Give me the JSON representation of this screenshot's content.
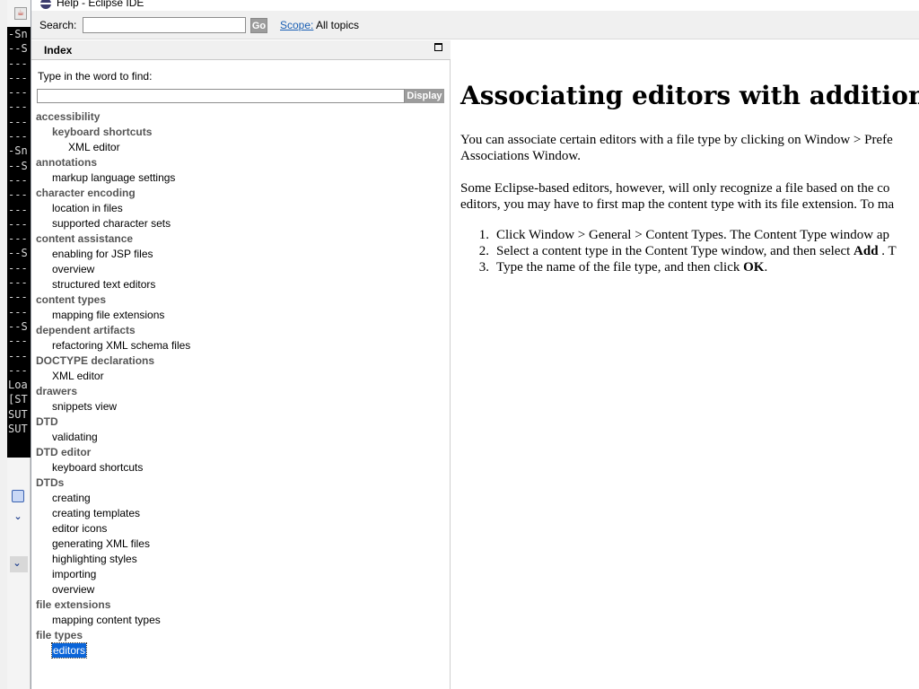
{
  "background": {
    "console_lines": [
      "-Sn",
      "--S",
      "---",
      "---",
      "---",
      "---",
      "---",
      "---",
      "-Sn",
      "--S",
      "---",
      "---",
      "---",
      "---",
      "---",
      "--S",
      "---",
      "---",
      "---",
      "---",
      "--S",
      "---",
      "---",
      "---",
      "Loa",
      "[ST",
      "SUT",
      "SUT"
    ],
    "java_icon": "java-icon"
  },
  "window": {
    "title": "Help - Eclipse IDE",
    "icon": "eclipse-icon"
  },
  "searchbar": {
    "label": "Search:",
    "value": "",
    "go_label": "Go",
    "scope_link": "Scope:",
    "scope_value": "All topics"
  },
  "nav": {
    "title": "Index",
    "find_label": "Type in the word to find:",
    "find_value": "",
    "display_label": "Display",
    "items": [
      {
        "level": 0,
        "text": "accessibility"
      },
      {
        "level": 1,
        "text": "keyboard shortcuts",
        "group": true
      },
      {
        "level": 2,
        "text": "XML editor"
      },
      {
        "level": 0,
        "text": "annotations"
      },
      {
        "level": 1,
        "text": "markup language settings"
      },
      {
        "level": 0,
        "text": "character encoding"
      },
      {
        "level": 1,
        "text": "location in files"
      },
      {
        "level": 1,
        "text": "supported character sets"
      },
      {
        "level": 0,
        "text": "content assistance"
      },
      {
        "level": 1,
        "text": "enabling for JSP files"
      },
      {
        "level": 1,
        "text": "overview"
      },
      {
        "level": 1,
        "text": "structured text editors"
      },
      {
        "level": 0,
        "text": "content types"
      },
      {
        "level": 1,
        "text": "mapping file extensions"
      },
      {
        "level": 0,
        "text": "dependent artifacts"
      },
      {
        "level": 1,
        "text": "refactoring XML schema files"
      },
      {
        "level": 0,
        "text": "DOCTYPE declarations"
      },
      {
        "level": 1,
        "text": "XML editor"
      },
      {
        "level": 0,
        "text": "drawers"
      },
      {
        "level": 1,
        "text": "snippets view"
      },
      {
        "level": 0,
        "text": "DTD"
      },
      {
        "level": 1,
        "text": "validating"
      },
      {
        "level": 0,
        "text": "DTD editor"
      },
      {
        "level": 1,
        "text": "keyboard shortcuts"
      },
      {
        "level": 0,
        "text": "DTDs"
      },
      {
        "level": 1,
        "text": "creating"
      },
      {
        "level": 1,
        "text": "creating templates"
      },
      {
        "level": 1,
        "text": "editor icons"
      },
      {
        "level": 1,
        "text": "generating XML files"
      },
      {
        "level": 1,
        "text": "highlighting styles"
      },
      {
        "level": 1,
        "text": "importing"
      },
      {
        "level": 1,
        "text": "overview"
      },
      {
        "level": 0,
        "text": "file extensions"
      },
      {
        "level": 1,
        "text": "mapping content types"
      },
      {
        "level": 0,
        "text": "file types"
      },
      {
        "level": 1,
        "text": "editors",
        "selected": true
      }
    ]
  },
  "content": {
    "title": "Associating editors with additional file",
    "para1_line1": "You can associate certain editors with a file type by clicking on Window > Prefe",
    "para1_line2": "Associations Window.",
    "para2_line1": "Some Eclipse-based editors, however, will only recognize a file based on the co",
    "para2_line2": "editors, you may have to first map the content type with its file extension. To ma",
    "steps": [
      {
        "num": "1.",
        "text": "Click Window > General > Content Types. The Content Type window ap",
        "bold": "",
        "tail": ""
      },
      {
        "num": "2.",
        "text": "Select a content type in the Content Type window, and then select ",
        "bold": "Add",
        "tail": " . T"
      },
      {
        "num": "3.",
        "text": "Type the name of the file type, and then click ",
        "bold": "OK",
        "tail": "."
      }
    ]
  }
}
